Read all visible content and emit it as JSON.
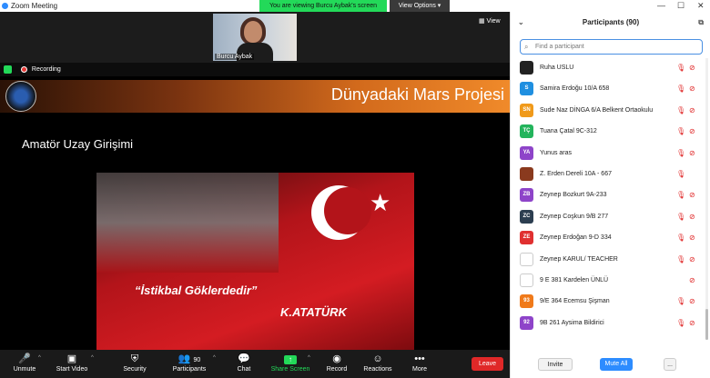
{
  "window": {
    "title": "Zoom Meeting",
    "minimize": "—",
    "maximize": "☐",
    "close": "✕"
  },
  "banner": {
    "viewing": "You are viewing Burcu Aybak's screen",
    "view_options": "View Options ▾"
  },
  "speaker": {
    "name": "Burcu Aybak",
    "view_button": "▦ View"
  },
  "status": {
    "recording": "Recording"
  },
  "slide": {
    "title": "Dünyadaki Mars Projesi",
    "subtitle": "Amatör Uzay Girişimi",
    "quote": "“İstikbal Göklerdedir”",
    "author": "K.ATATÜRK"
  },
  "toolbar": {
    "unmute": "Unmute",
    "start_video": "Start Video",
    "security": "Security",
    "participants": "Participants",
    "participants_count": "90",
    "chat": "Chat",
    "share_screen": "Share Screen",
    "record": "Record",
    "reactions": "Reactions",
    "more": "More",
    "leave": "Leave"
  },
  "panel": {
    "title": "Participants (90)",
    "search_placeholder": "Find a participant",
    "invite": "Invite",
    "mute_all": "Mute All",
    "more": "..."
  },
  "participants": [
    {
      "initials": "",
      "name": "Ruha USLU",
      "avatar_color": "#222222",
      "mic_muted": true,
      "cam_off": true
    },
    {
      "initials": "S",
      "name": "Samira Erdoğu 10/A 658",
      "avatar_color": "#1f8fe0",
      "mic_muted": true,
      "cam_off": true
    },
    {
      "initials": "SN",
      "name": "Sude Naz DİNGA 6/A Belkent Ortaokulu",
      "avatar_color": "#f09a1a",
      "mic_muted": true,
      "cam_off": true
    },
    {
      "initials": "TÇ",
      "name": "Tuana Çatal 9C-312",
      "avatar_color": "#23b45c",
      "mic_muted": true,
      "cam_off": true
    },
    {
      "initials": "YA",
      "name": "Yunus aras",
      "avatar_color": "#8e44c9",
      "mic_muted": true,
      "cam_off": true
    },
    {
      "initials": "",
      "name": "Z. Erden Dereli 10A - 667",
      "avatar_color": "#8a3a1e",
      "mic_muted": true,
      "cam_off": false
    },
    {
      "initials": "ZB",
      "name": "Zeynep Bozkurt 9A-233",
      "avatar_color": "#8e44c9",
      "mic_muted": true,
      "cam_off": true
    },
    {
      "initials": "ZC",
      "name": "Zeynep Coşkun 9/B 277",
      "avatar_color": "#2c3e50",
      "mic_muted": true,
      "cam_off": true
    },
    {
      "initials": "ZE",
      "name": "Zeynep Erdoğan 9-D 334",
      "avatar_color": "#e03030",
      "mic_muted": true,
      "cam_off": true
    },
    {
      "initials": "",
      "name": "Zeynep KARUL/ TEACHER",
      "avatar_color": "#ffffff",
      "mic_muted": true,
      "cam_off": true
    },
    {
      "initials": "",
      "name": "9 E 381 Kardelen ÜNLÜ",
      "avatar_color": "#ffffff",
      "mic_muted": false,
      "cam_off": true
    },
    {
      "initials": "93",
      "name": "9/E 364 Ecemsu Şişman",
      "avatar_color": "#f07a1a",
      "mic_muted": true,
      "cam_off": true
    },
    {
      "initials": "92",
      "name": "9B 261 Aysima Bildirici",
      "avatar_color": "#8e44c9",
      "mic_muted": true,
      "cam_off": true
    }
  ]
}
